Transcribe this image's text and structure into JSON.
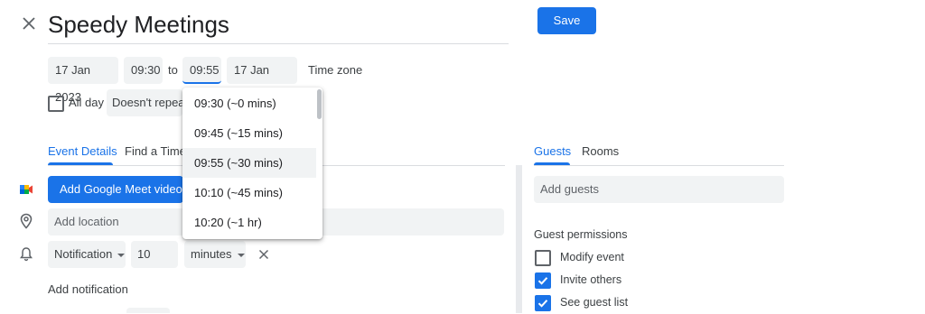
{
  "header": {
    "title": "Speedy Meetings",
    "save_label": "Save",
    "close_icon": "close-icon"
  },
  "datetime": {
    "start_date": "17 Jan 2023",
    "start_time": "09:30",
    "to_label": "to",
    "end_time": "09:55",
    "end_date": "17 Jan 2023",
    "timezone_label": "Time zone"
  },
  "options": {
    "all_day_label": "All day",
    "all_day_checked": false,
    "repeat_value": "Doesn't repeat"
  },
  "time_dropdown": {
    "items": [
      "09:30 (~0 mins)",
      "09:45 (~15 mins)",
      "09:55 (~30 mins)",
      "10:10 (~45 mins)",
      "10:20 (~1 hr)"
    ],
    "selected_index": 2
  },
  "left_tabs": [
    {
      "label": "Event Details",
      "active": true
    },
    {
      "label": "Find a Time",
      "active": false
    }
  ],
  "details": {
    "meet_button_label": "Add Google Meet video conferencing",
    "location_placeholder": "Add location",
    "notification_type": "Notification",
    "notification_value": "10",
    "notification_unit": "minutes",
    "add_notification_label": "Add notification"
  },
  "right_tabs": [
    {
      "label": "Guests",
      "active": true
    },
    {
      "label": "Rooms",
      "active": false
    }
  ],
  "guests": {
    "input_placeholder": "Add guests",
    "permissions_title": "Guest permissions",
    "permissions": [
      {
        "label": "Modify event",
        "checked": false
      },
      {
        "label": "Invite others",
        "checked": true
      },
      {
        "label": "See guest list",
        "checked": true
      }
    ]
  },
  "colors": {
    "accent": "#1a73e8",
    "field_bg": "#f1f3f4",
    "divider": "#dadce0"
  }
}
